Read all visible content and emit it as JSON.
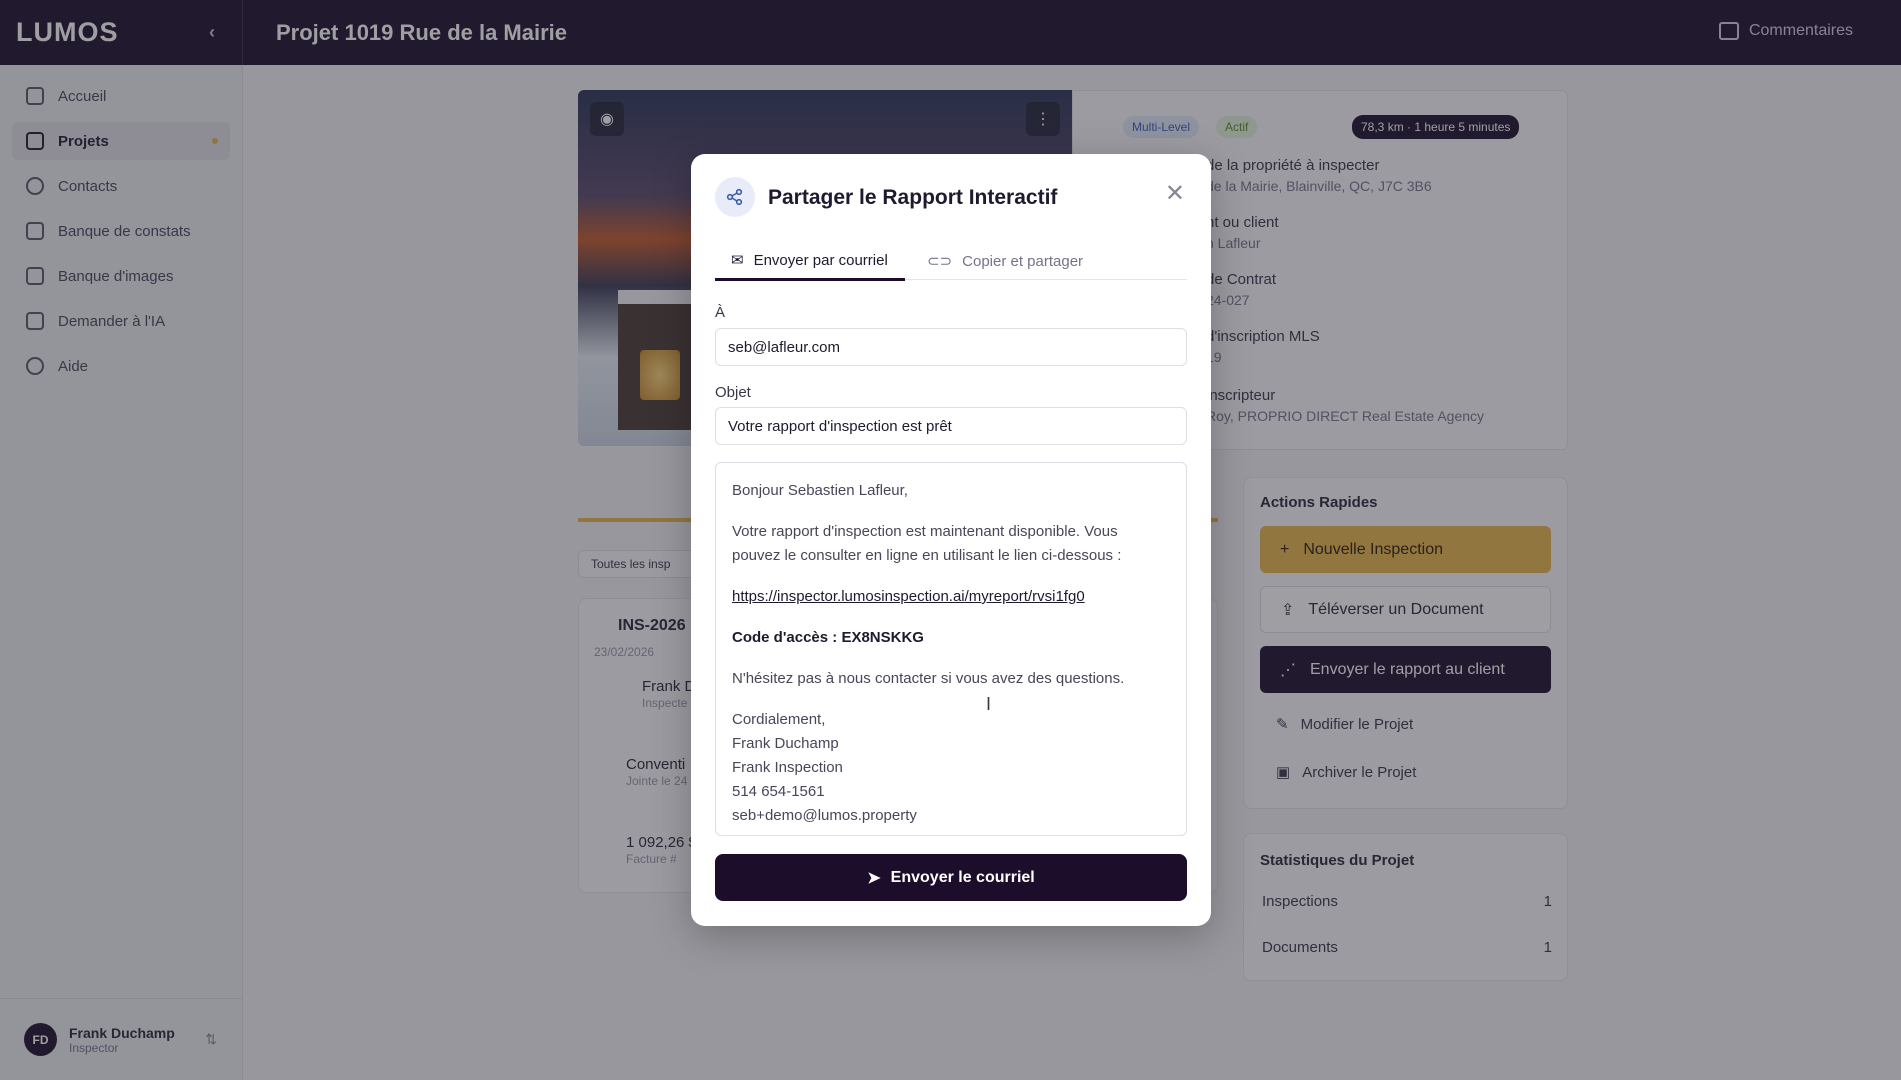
{
  "app": {
    "logo": "LUMOS",
    "collapse_icon": "chevron-left-icon"
  },
  "header": {
    "title": "Projet 1019 Rue de la Mairie",
    "comments_label": "Commentaires"
  },
  "sidebar": {
    "items": [
      {
        "label": "Accueil",
        "icon": "home-icon"
      },
      {
        "label": "Projets",
        "icon": "folder-icon",
        "active": true
      },
      {
        "label": "Contacts",
        "icon": "user-icon"
      },
      {
        "label": "Banque de constats",
        "icon": "book-icon"
      },
      {
        "label": "Banque d'images",
        "icon": "image-icon"
      },
      {
        "label": "Demander à l'IA",
        "icon": "chat-icon"
      },
      {
        "label": "Aide",
        "icon": "help-icon"
      }
    ],
    "user": {
      "initials": "FD",
      "name": "Frank Duchamp",
      "role": "Inspector"
    }
  },
  "project": {
    "chips": {
      "type": "Multi-Level",
      "status": "Actif",
      "distance": "78,3 km · 1 heure 5 minutes"
    },
    "info": [
      {
        "label": "de la propriété à inspecter",
        "value": "de la Mairie, Blainville, QC, J7C 3B6"
      },
      {
        "label": "nt ou client",
        "value": "n Lafleur"
      },
      {
        "label": "de Contrat",
        "value": "24-027"
      },
      {
        "label": "d'inscription MLS",
        "value": "19"
      },
      {
        "label": "inscripteur",
        "value": "Roy, PROPRIO DIRECT Real Estate Agency"
      }
    ],
    "filter_label": "Toutes les insp",
    "inspection": {
      "id": "INS-2026",
      "date": "23/02/2026",
      "inspector": "Frank D",
      "inspector_role": "Inspecte"
    },
    "convention": {
      "title": "Conventi",
      "sub": "Jointe le 24"
    },
    "invoice": {
      "amount": "1 092,26 $",
      "sub": "Facture #"
    }
  },
  "actions": {
    "title": "Actions Rapides",
    "new_inspection": "Nouvelle Inspection",
    "upload": "Téléverser un Document",
    "send_report": "Envoyer le rapport au client",
    "edit": "Modifier le Projet",
    "archive": "Archiver le Projet"
  },
  "stats": {
    "title": "Statistiques du Projet",
    "rows": [
      {
        "label": "Inspections",
        "value": "1"
      },
      {
        "label": "Documents",
        "value": "1"
      }
    ]
  },
  "modal": {
    "title": "Partager le Rapport Interactif",
    "tabs": {
      "email": "Envoyer par courriel",
      "copy": "Copier et partager"
    },
    "to_label": "À",
    "to_value": "seb@lafleur.com",
    "subject_label": "Objet",
    "subject_value": "Votre rapport d'inspection est prêt",
    "body": {
      "greeting": "Bonjour Sebastien Lafleur,",
      "intro": "Votre rapport d'inspection est maintenant disponible. Vous pouvez le consulter en ligne en utilisant le lien ci-dessous :",
      "link": "https://inspector.lumosinspection.ai/myreport/rvsi1fg0",
      "code": "Code d'accès : EX8NSKKG",
      "questions": "N'hésitez pas à nous contacter si vous avez des questions.",
      "closing": "Cordialement,",
      "sig_name": "Frank Duchamp",
      "sig_company": "Frank Inspection",
      "sig_phone": "514 654-1561",
      "sig_email": "seb+demo@lumos.property"
    },
    "send_label": "Envoyer le courriel"
  },
  "colors": {
    "brand_dark": "#1c0e2a",
    "accent_gold": "#e9b64a",
    "chip_blue": "#3c5bb5",
    "chip_green": "#5a8a2a"
  }
}
